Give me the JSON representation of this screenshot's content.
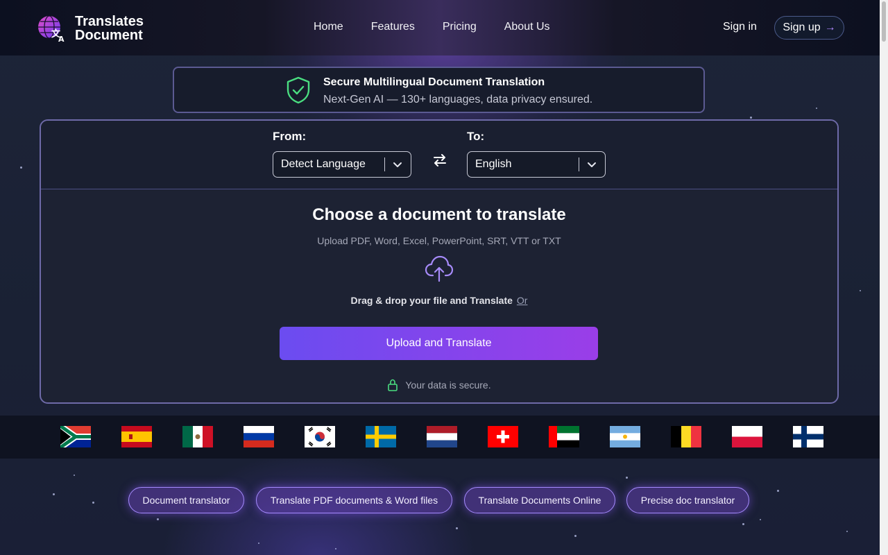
{
  "header": {
    "logo_line1": "Translates",
    "logo_line2": "Document",
    "nav": [
      "Home",
      "Features",
      "Pricing",
      "About Us"
    ],
    "signin": "Sign in",
    "signup": "Sign up",
    "signup_arrow": "→"
  },
  "banner": {
    "title": "Secure Multilingual Document Translation",
    "subtitle": "Next-Gen AI — 130+ languages, data privacy ensured.",
    "icon": "shield-check-icon"
  },
  "translator": {
    "from_label": "From:",
    "from_value": "Detect Language",
    "to_label": "To:",
    "to_value": "English",
    "heading": "Choose a document to translate",
    "formats": "Upload PDF, Word, Excel, PowerPoint, SRT, VTT or TXT",
    "drag_text": "Drag & drop your file and Translate",
    "or_text": "Or",
    "upload_button": "Upload and Translate",
    "secure_text": "Your data is secure."
  },
  "flags": [
    "south-africa",
    "spain",
    "mexico",
    "russia",
    "south-korea",
    "sweden",
    "netherlands",
    "switzerland",
    "uae",
    "argentina",
    "belgium",
    "poland",
    "finland"
  ],
  "tags": [
    "Document translator",
    "Translate PDF documents & Word files",
    "Translate Documents Online",
    "Precise doc translator"
  ],
  "colors": {
    "accent": "#8b5cf6",
    "button_start": "#6b4cf0",
    "button_end": "#9a3ee8",
    "shield_green": "#4ade80"
  }
}
